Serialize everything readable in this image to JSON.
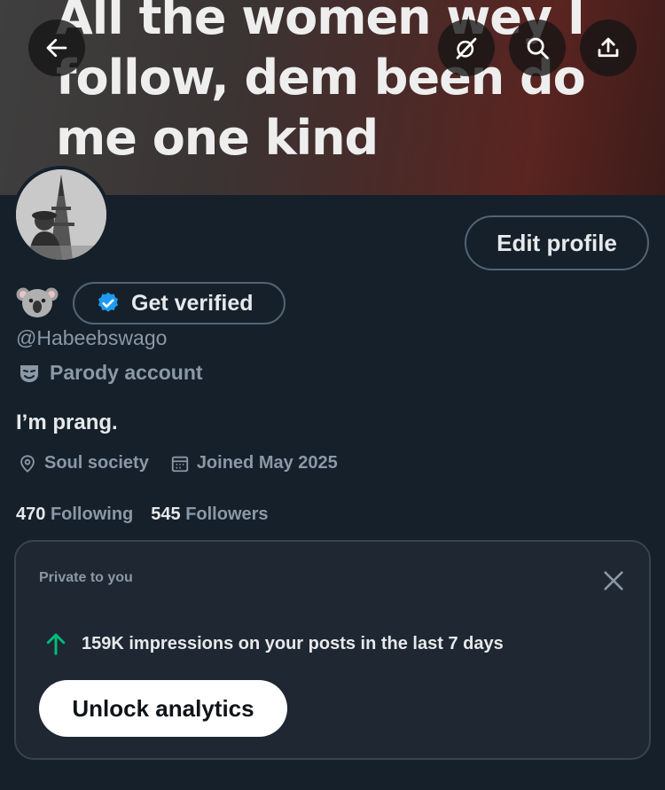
{
  "banner": {
    "text": "All the women wey I follow, dem been do me one kind"
  },
  "header": {
    "back_icon": "back-arrow-icon",
    "grok_icon": "grok-icon",
    "search_icon": "search-icon",
    "share_icon": "share-icon"
  },
  "profile": {
    "edit_label": "Edit profile",
    "display_name_emoji": "koala-emoji",
    "verify_label": "Get verified",
    "handle": "@Habeebswago",
    "parody_label": "Parody account",
    "bio": "I’m prang.",
    "location": "Soul society",
    "joined": "Joined May 2025",
    "following_count": "470",
    "following_label": "Following",
    "followers_count": "545",
    "followers_label": "Followers"
  },
  "analytics_card": {
    "label": "Private to you",
    "impressions_text": "159K impressions on your posts in the last 7 days",
    "unlock_label": "Unlock analytics",
    "trend_color": "#00ba7c"
  },
  "colors": {
    "background": "#15202b",
    "verified_blue": "#1d9bf0",
    "secondary_text": "#8b98a5"
  }
}
